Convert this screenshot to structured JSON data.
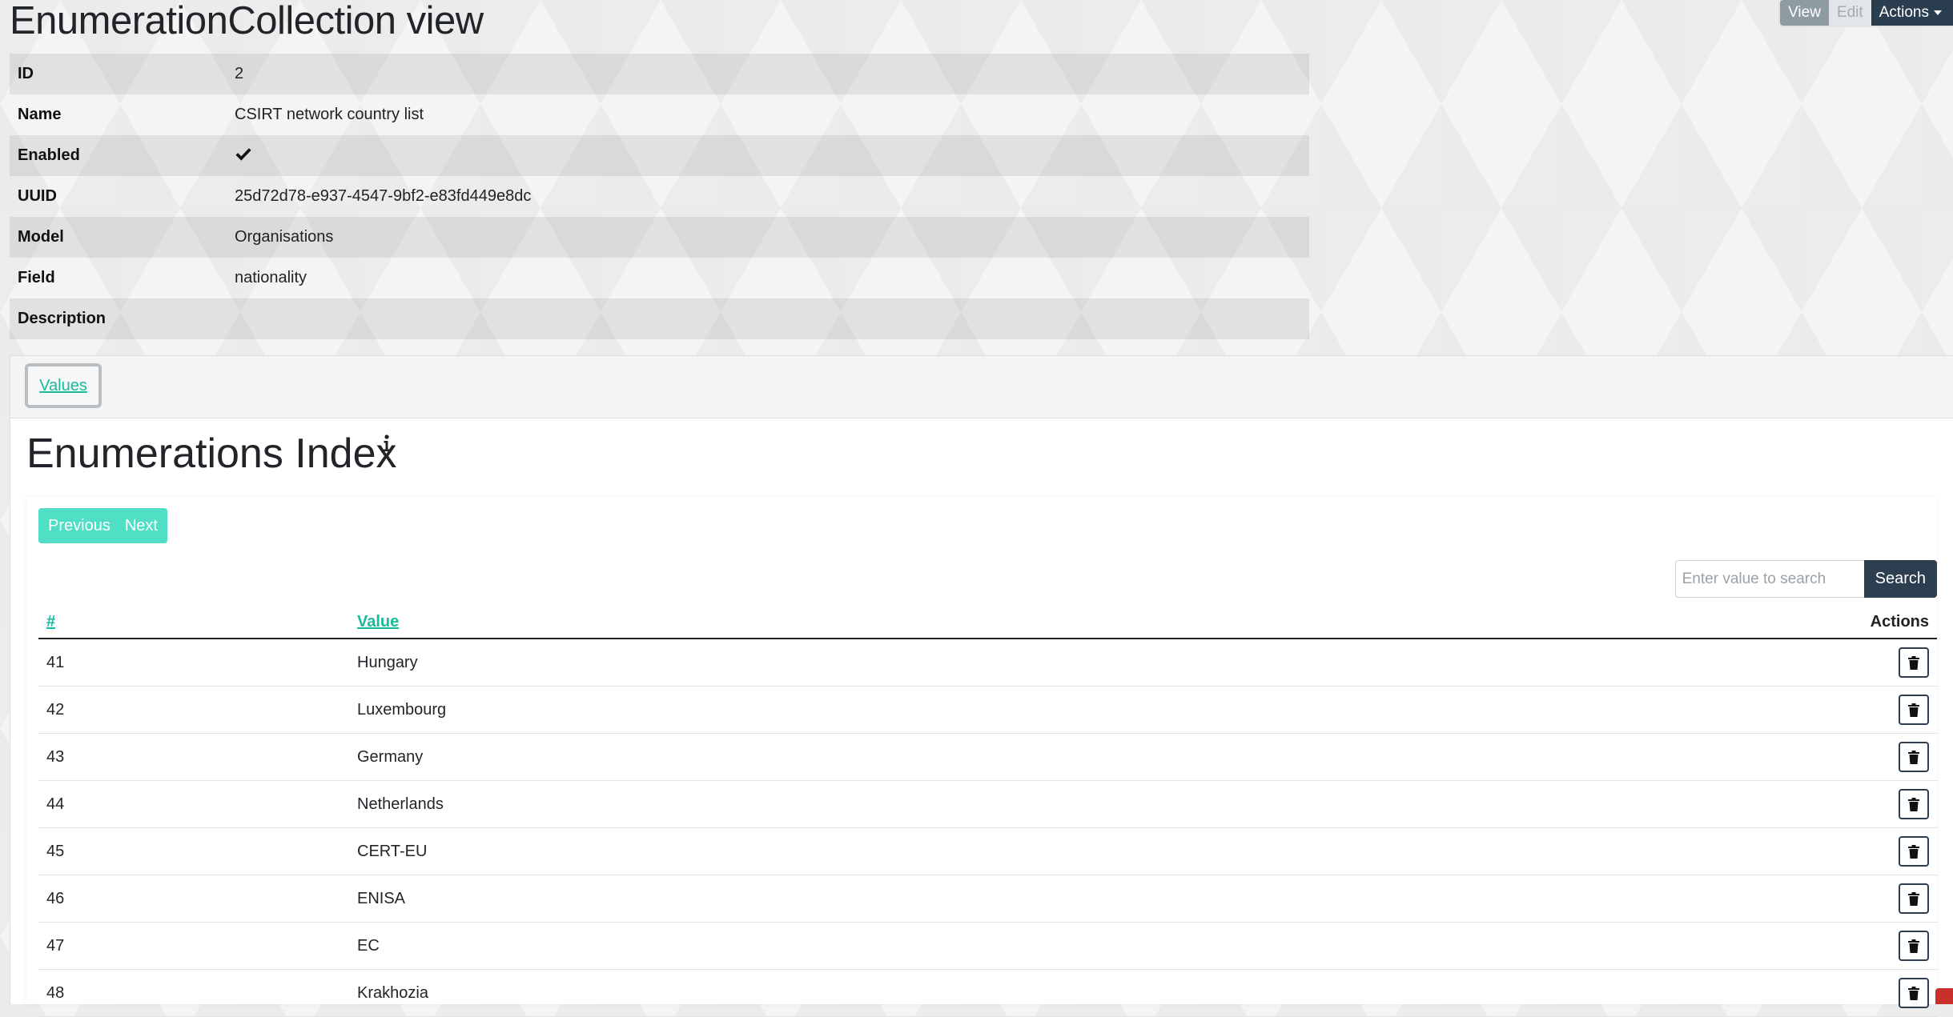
{
  "page": {
    "title": "EnumerationCollection view"
  },
  "top_actions": {
    "view": "View",
    "edit": "Edit",
    "actions": "Actions"
  },
  "details": {
    "rows": [
      {
        "label": "ID",
        "value": "2"
      },
      {
        "label": "Name",
        "value": "CSIRT network country list"
      },
      {
        "label": "Enabled",
        "value": ""
      },
      {
        "label": "UUID",
        "value": "25d72d78-e937-4547-9bf2-e83fd449e8dc"
      },
      {
        "label": "Model",
        "value": "Organisations"
      },
      {
        "label": "Field",
        "value": "nationality"
      },
      {
        "label": "Description",
        "value": ""
      }
    ],
    "enabled_icon": "checkmark-icon"
  },
  "tabs": {
    "values": "Values"
  },
  "index": {
    "title": "Enumerations Index",
    "info_icon": "info-icon",
    "pager": {
      "previous": "Previous",
      "next": "Next"
    },
    "search": {
      "placeholder": "Enter value to search",
      "button": "Search"
    },
    "columns": {
      "id": "#",
      "value": "Value",
      "actions": "Actions"
    },
    "rows": [
      {
        "id": "41",
        "value": "Hungary"
      },
      {
        "id": "42",
        "value": "Luxembourg"
      },
      {
        "id": "43",
        "value": "Germany"
      },
      {
        "id": "44",
        "value": "Netherlands"
      },
      {
        "id": "45",
        "value": "CERT-EU"
      },
      {
        "id": "46",
        "value": "ENISA"
      },
      {
        "id": "47",
        "value": "EC"
      },
      {
        "id": "48",
        "value": "Krakhozia"
      }
    ],
    "delete_icon": "trash-icon"
  },
  "colors": {
    "accent": "#18bc9c",
    "primary": "#2c3e50",
    "pager": "#5ce0c8"
  }
}
